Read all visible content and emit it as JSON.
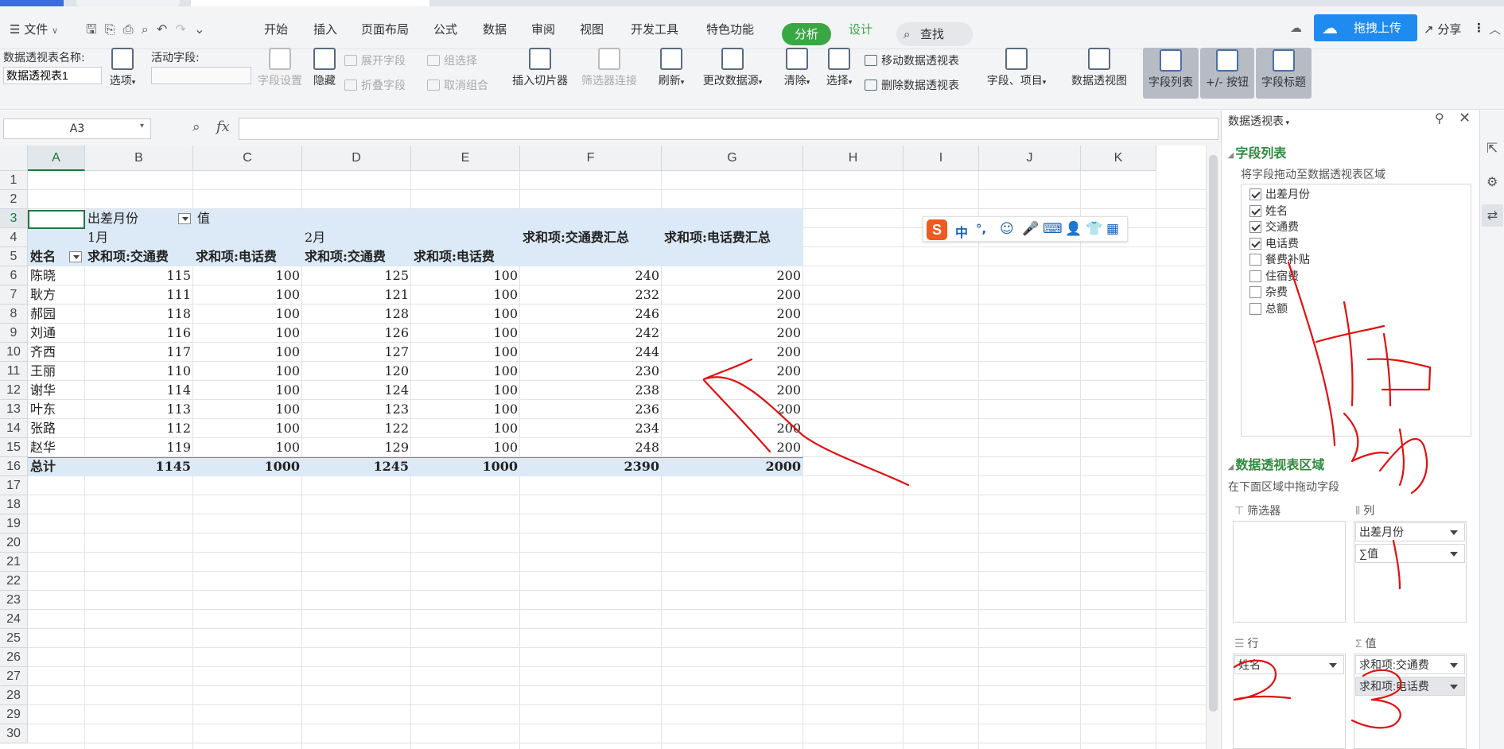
{
  "menubar": {
    "file_label": "文件",
    "tabs": [
      "开始",
      "插入",
      "页面布局",
      "公式",
      "数据",
      "审阅",
      "视图",
      "开发工具",
      "特色功能"
    ],
    "analysis_tab": "分析",
    "design_tab": "设计",
    "search_label": "查找",
    "upload_label": "拖拽上传",
    "share_label": "分享"
  },
  "ribbon": {
    "pivot_name_label": "数据透视表名称:",
    "pivot_name_value": "数据透视表1",
    "options_label": "选项",
    "active_field_label": "活动字段:",
    "field_settings": "字段设置",
    "hide": "隐藏",
    "expand_field": "展开字段",
    "collapse_field": "折叠字段",
    "group_selection": "组选择",
    "ungroup": "取消组合",
    "insert_slicer": "插入切片器",
    "filter_connections": "筛选器连接",
    "refresh": "刷新",
    "change_source": "更改数据源",
    "clear": "清除",
    "select": "选择",
    "move_pivot": "移动数据透视表",
    "delete_pivot": "删除数据透视表",
    "fields_items": "字段、项目",
    "pivot_chart": "数据透视图",
    "field_list": "字段列表",
    "plus_minus": "+/- 按钮",
    "field_headers": "字段标题"
  },
  "formula": {
    "namebox": "A3",
    "fx_label": "fx",
    "value": ""
  },
  "grid": {
    "columns": [
      "A",
      "B",
      "C",
      "D",
      "E",
      "F",
      "G",
      "H",
      "I",
      "J",
      "K"
    ],
    "rows": [
      "1",
      "2",
      "3",
      "4",
      "5",
      "6",
      "7",
      "8",
      "9",
      "10",
      "11",
      "12",
      "13",
      "14",
      "15",
      "16",
      "17",
      "18",
      "19",
      "20",
      "21",
      "22",
      "23",
      "24",
      "25",
      "26",
      "27",
      "28",
      "29",
      "30"
    ],
    "pivot": {
      "col_field": "出差月份",
      "values_label": "值",
      "month1": "1月",
      "month2": "2月",
      "total_traffic": "求和项:交通费汇总",
      "total_phone": "求和项:电话费汇总",
      "row_field": "姓名",
      "h_traffic": "求和项:交通费",
      "h_phone": "求和项:电话费",
      "data": [
        [
          "陈晓",
          "115",
          "100",
          "125",
          "100",
          "240",
          "200"
        ],
        [
          "耿方",
          "111",
          "100",
          "121",
          "100",
          "232",
          "200"
        ],
        [
          "郝园",
          "118",
          "100",
          "128",
          "100",
          "246",
          "200"
        ],
        [
          "刘通",
          "116",
          "100",
          "126",
          "100",
          "242",
          "200"
        ],
        [
          "齐西",
          "117",
          "100",
          "127",
          "100",
          "244",
          "200"
        ],
        [
          "王丽",
          "110",
          "100",
          "120",
          "100",
          "230",
          "200"
        ],
        [
          "谢华",
          "114",
          "100",
          "124",
          "100",
          "238",
          "200"
        ],
        [
          "叶东",
          "113",
          "100",
          "123",
          "100",
          "236",
          "200"
        ],
        [
          "张路",
          "112",
          "100",
          "122",
          "100",
          "234",
          "200"
        ],
        [
          "赵华",
          "119",
          "100",
          "129",
          "100",
          "248",
          "200"
        ]
      ],
      "total": [
        "总计",
        "1145",
        "1000",
        "1245",
        "1000",
        "2390",
        "2000"
      ]
    }
  },
  "ime": {
    "mode": "中",
    "punct": "°,"
  },
  "panel": {
    "title": "数据透视表",
    "field_list_heading": "字段列表",
    "field_list_hint": "将字段拖动至数据透视表区域",
    "fields": [
      {
        "label": "出差月份",
        "checked": true
      },
      {
        "label": "姓名",
        "checked": true
      },
      {
        "label": "交通费",
        "checked": true
      },
      {
        "label": "电话费",
        "checked": true
      },
      {
        "label": "餐费补贴",
        "checked": false
      },
      {
        "label": "住宿费",
        "checked": false
      },
      {
        "label": "杂费",
        "checked": false
      },
      {
        "label": "总额",
        "checked": false
      }
    ],
    "areas_heading": "数据透视表区域",
    "areas_hint": "在下面区域中拖动字段",
    "filter_label": "筛选器",
    "columns_label": "列",
    "rows_label": "行",
    "values_label": "值",
    "columns_items": [
      "出差月份",
      "∑值"
    ],
    "rows_items": [
      "姓名"
    ],
    "values_items": [
      "求和项:交通费",
      "求和项:电话费"
    ]
  },
  "colors": {
    "accent_green": "#3aa745",
    "pivot_band": "#dce9f6",
    "upload_blue": "#1f8bf0",
    "annotation_red": "#e01010"
  }
}
